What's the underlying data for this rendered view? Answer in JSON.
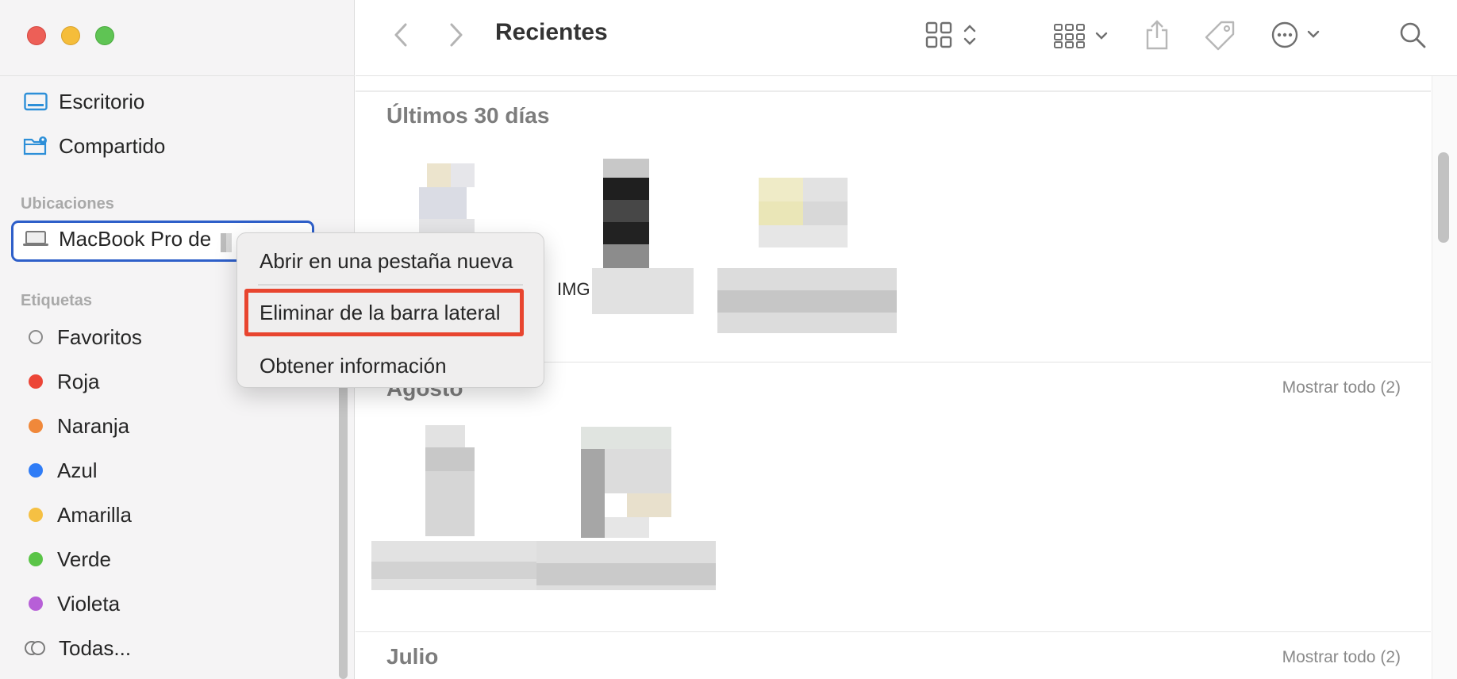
{
  "window": {
    "title": "Recientes"
  },
  "sidebar": {
    "favorites": [
      {
        "label": "Escritorio",
        "icon": "desktop-icon"
      },
      {
        "label": "Compartido",
        "icon": "shared-folder-icon"
      }
    ],
    "locations_header": "Ubicaciones",
    "locations": [
      {
        "label": "MacBook Pro de",
        "icon": "laptop-icon"
      }
    ],
    "tags_header": "Etiquetas",
    "tags": [
      {
        "label": "Favoritos",
        "color": "none"
      },
      {
        "label": "Roja",
        "color": "#ec4537"
      },
      {
        "label": "Naranja",
        "color": "#f0883a"
      },
      {
        "label": "Azul",
        "color": "#2f7cf6"
      },
      {
        "label": "Amarilla",
        "color": "#f5c043"
      },
      {
        "label": "Verde",
        "color": "#5ac447"
      },
      {
        "label": "Violeta",
        "color": "#b75fd7"
      },
      {
        "label": "Todas...",
        "icon": "all-tags-icon"
      }
    ]
  },
  "toolbar": {
    "back_icon": "chevron-left-icon",
    "forward_icon": "chevron-right-icon",
    "view_icon": "grid-view-icon",
    "group_icon": "group-view-icon",
    "share_icon": "share-icon",
    "tag_icon": "tag-icon",
    "more_icon": "more-options-icon",
    "search_icon": "search-icon"
  },
  "content": {
    "sections": [
      {
        "title": "Últimos 30 días",
        "link": ""
      },
      {
        "title": "Agosto",
        "link": "Mostrar todo (2)"
      },
      {
        "title": "Julio",
        "link": "Mostrar todo (2)"
      }
    ],
    "file_label": "IMG"
  },
  "context_menu": {
    "items": [
      "Abrir en una pestaña nueva",
      "Eliminar de la barra lateral",
      "Obtener información"
    ],
    "highlight_color": "#e8452f"
  }
}
